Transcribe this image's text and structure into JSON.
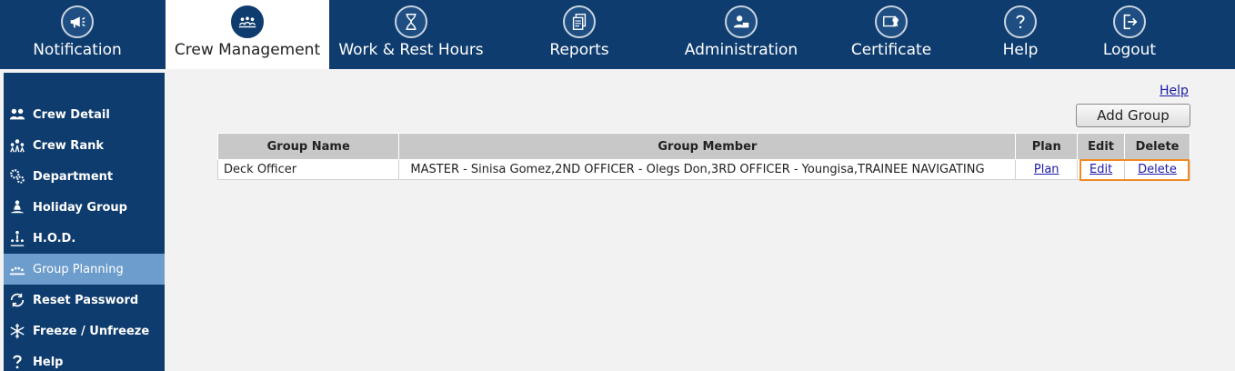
{
  "topnav": [
    {
      "label": "Notification",
      "icon": "megaphone-icon"
    },
    {
      "label": "Crew Management",
      "icon": "crew-group-icon"
    },
    {
      "label": "Work & Rest Hours",
      "icon": "hourglass-icon"
    },
    {
      "label": "Reports",
      "icon": "documents-icon"
    },
    {
      "label": "Administration",
      "icon": "admin-user-icon"
    },
    {
      "label": "Certificate",
      "icon": "certificate-icon"
    },
    {
      "label": "Help",
      "icon": "question-icon"
    },
    {
      "label": "Logout",
      "icon": "logout-icon"
    }
  ],
  "sidebar": [
    {
      "label": "Crew Detail",
      "icon": "people-icon"
    },
    {
      "label": "Crew Rank",
      "icon": "rank-icon"
    },
    {
      "label": "Department",
      "icon": "gears-icon"
    },
    {
      "label": "Holiday Group",
      "icon": "meditation-icon"
    },
    {
      "label": "H.O.D.",
      "icon": "hierarchy-icon"
    },
    {
      "label": "Group Planning",
      "icon": "group-planning-icon"
    },
    {
      "label": "Reset Password",
      "icon": "password-reset-icon"
    },
    {
      "label": "Freeze / Unfreeze",
      "icon": "snowflake-icon"
    },
    {
      "label": "Help",
      "icon": "question-icon"
    }
  ],
  "main": {
    "help_link": "Help",
    "add_button": "Add Group",
    "table": {
      "headers": [
        "Group Name",
        "Group Member",
        "Plan",
        "Edit",
        "Delete"
      ],
      "rows": [
        {
          "group_name": "Deck Officer",
          "group_member": "MASTER - Sinisa Gomez,2ND OFFICER - Olegs Don,3RD OFFICER - Youngisa,TRAINEE NAVIGATING",
          "plan": "Plan",
          "edit": "Edit",
          "delete": "Delete"
        }
      ]
    }
  },
  "colors": {
    "nav_bg": "#0e3c6e",
    "sidebar_active": "#6d9dcc",
    "highlight": "#f08a24",
    "link": "#1a1aa6"
  }
}
